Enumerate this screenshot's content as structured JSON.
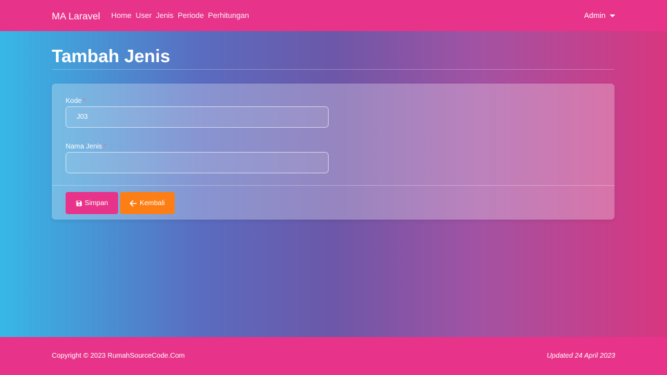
{
  "navbar": {
    "brand": "MA Laravel",
    "links": [
      "Home",
      "User",
      "Jenis",
      "Periode",
      "Perhitungan"
    ],
    "user_menu": "Admin"
  },
  "page": {
    "title": "Tambah Jenis"
  },
  "form": {
    "kode": {
      "label": "Kode",
      "required_mark": "*",
      "value": "J03"
    },
    "nama_jenis": {
      "label": "Nama Jenis",
      "required_mark": "*",
      "value": ""
    },
    "save_label": "Simpan",
    "back_label": "Kembali"
  },
  "footer": {
    "copyright": "Copyright © 2023 RumahSourceCode.Com",
    "updated": "Updated 24 April 2023"
  },
  "colors": {
    "primary": "#e8338a",
    "warning": "#fd7e14"
  },
  "icons": {
    "save": "floppy-disk-icon",
    "back": "arrow-left-icon",
    "user_menu": "caret-down-icon"
  }
}
